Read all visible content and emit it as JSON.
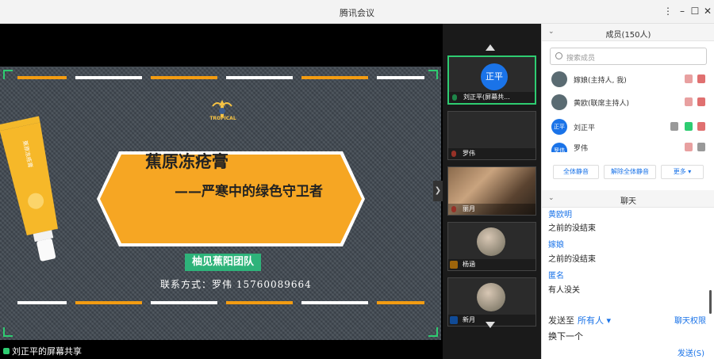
{
  "window": {
    "title": "腾讯会议"
  },
  "slide": {
    "logo_text": "TROPICAL",
    "tube_label": "蕉原冻疮膏",
    "title": "蕉原冻疮膏",
    "subtitle": "——严寒中的绿色守卫者",
    "team": "柚见蕉阳团队",
    "contact": "联系方式：罗伟 15760089664"
  },
  "share_status": "刘正平的屏幕共享",
  "videos": [
    {
      "avatar_text": "正平",
      "name": "刘正平(屏幕共...",
      "mic": "on"
    },
    {
      "name": "罗伟",
      "mic": "off"
    },
    {
      "name": "丽月",
      "mic": "off"
    },
    {
      "name": "杨涵",
      "mic": "off"
    },
    {
      "name": "新月",
      "mic": "off"
    }
  ],
  "members_panel": {
    "header": "成员(150人)",
    "search_placeholder": "搜索成员",
    "members": [
      {
        "avatar_text": "",
        "name": "嫁娘(主持人, 我)"
      },
      {
        "avatar_text": "",
        "name": "黄欧(联席主持人)"
      },
      {
        "avatar_text": "正平",
        "name": "刘正平"
      },
      {
        "avatar_text": "罗伟",
        "name": "罗伟"
      }
    ],
    "buttons": {
      "mute_all": "全体静音",
      "unmute_all": "解除全体静音",
      "more": "更多 ▾"
    }
  },
  "chat_panel": {
    "header": "聊天",
    "messages": [
      {
        "sender": "黄欧明",
        "text": "之前的没结束"
      },
      {
        "sender": "嫁娘",
        "text": "之前的没结束"
      },
      {
        "sender": "匿名",
        "text": "有人没关"
      }
    ],
    "send_to_label": "发送至",
    "send_to_value": "所有人 ▾",
    "permission": "聊天权限",
    "input_text": "换下一个",
    "send_button": "发送(S)"
  },
  "colors": {
    "accent": "#1a73e8",
    "green": "#2ecc71",
    "banner": "#f6a623"
  }
}
